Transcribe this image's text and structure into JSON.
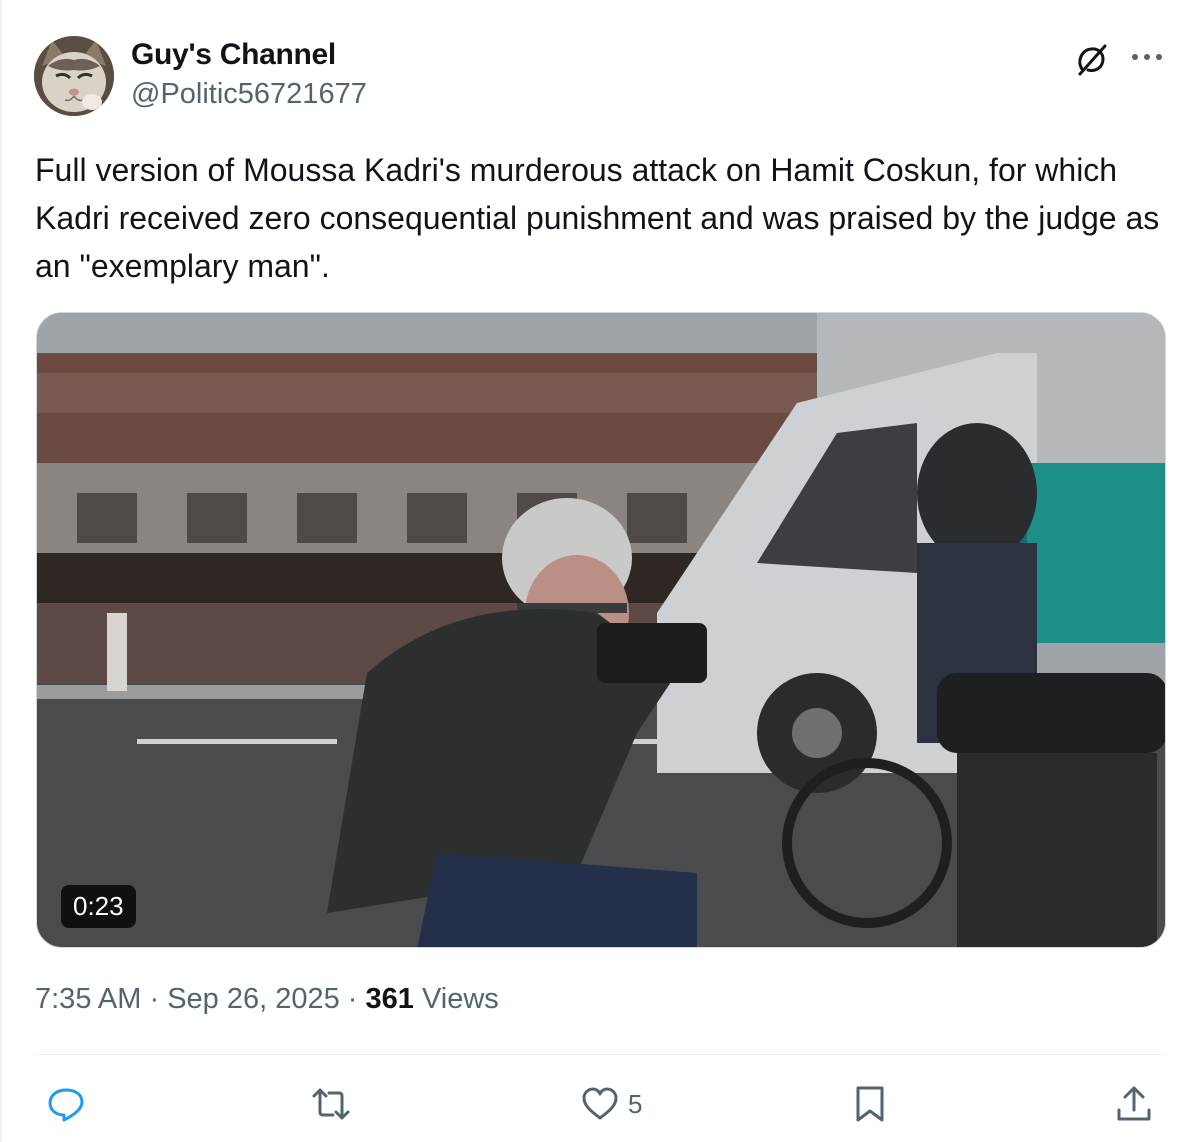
{
  "author": {
    "display_name": "Guy's Channel",
    "handle": "@Politic56721677",
    "avatar_icon": "cat-avatar"
  },
  "header_icons": {
    "grok": "grok-icon",
    "more": "more-icon"
  },
  "tweet": {
    "text": "Full version of Moussa Kadri's murderous attack on Hamit Coskun, for which Kadri received zero consequential punishment and was praised by the judge as an \"exemplary man\"."
  },
  "media": {
    "type": "video",
    "duration": "0:23"
  },
  "meta": {
    "time": "7:35 AM",
    "separator": " · ",
    "date": "Sep 26, 2025",
    "views_count": "361",
    "views_label": "Views"
  },
  "actions": {
    "reply_count": "",
    "retweet_count": "",
    "like_count": "5",
    "bookmark_count": "",
    "icons": [
      "reply-icon",
      "retweet-icon",
      "like-icon",
      "bookmark-icon",
      "share-icon"
    ]
  },
  "colors": {
    "text_primary": "#0f1419",
    "text_secondary": "#536471",
    "divider": "#eff3f4",
    "border": "#cfd9de"
  }
}
